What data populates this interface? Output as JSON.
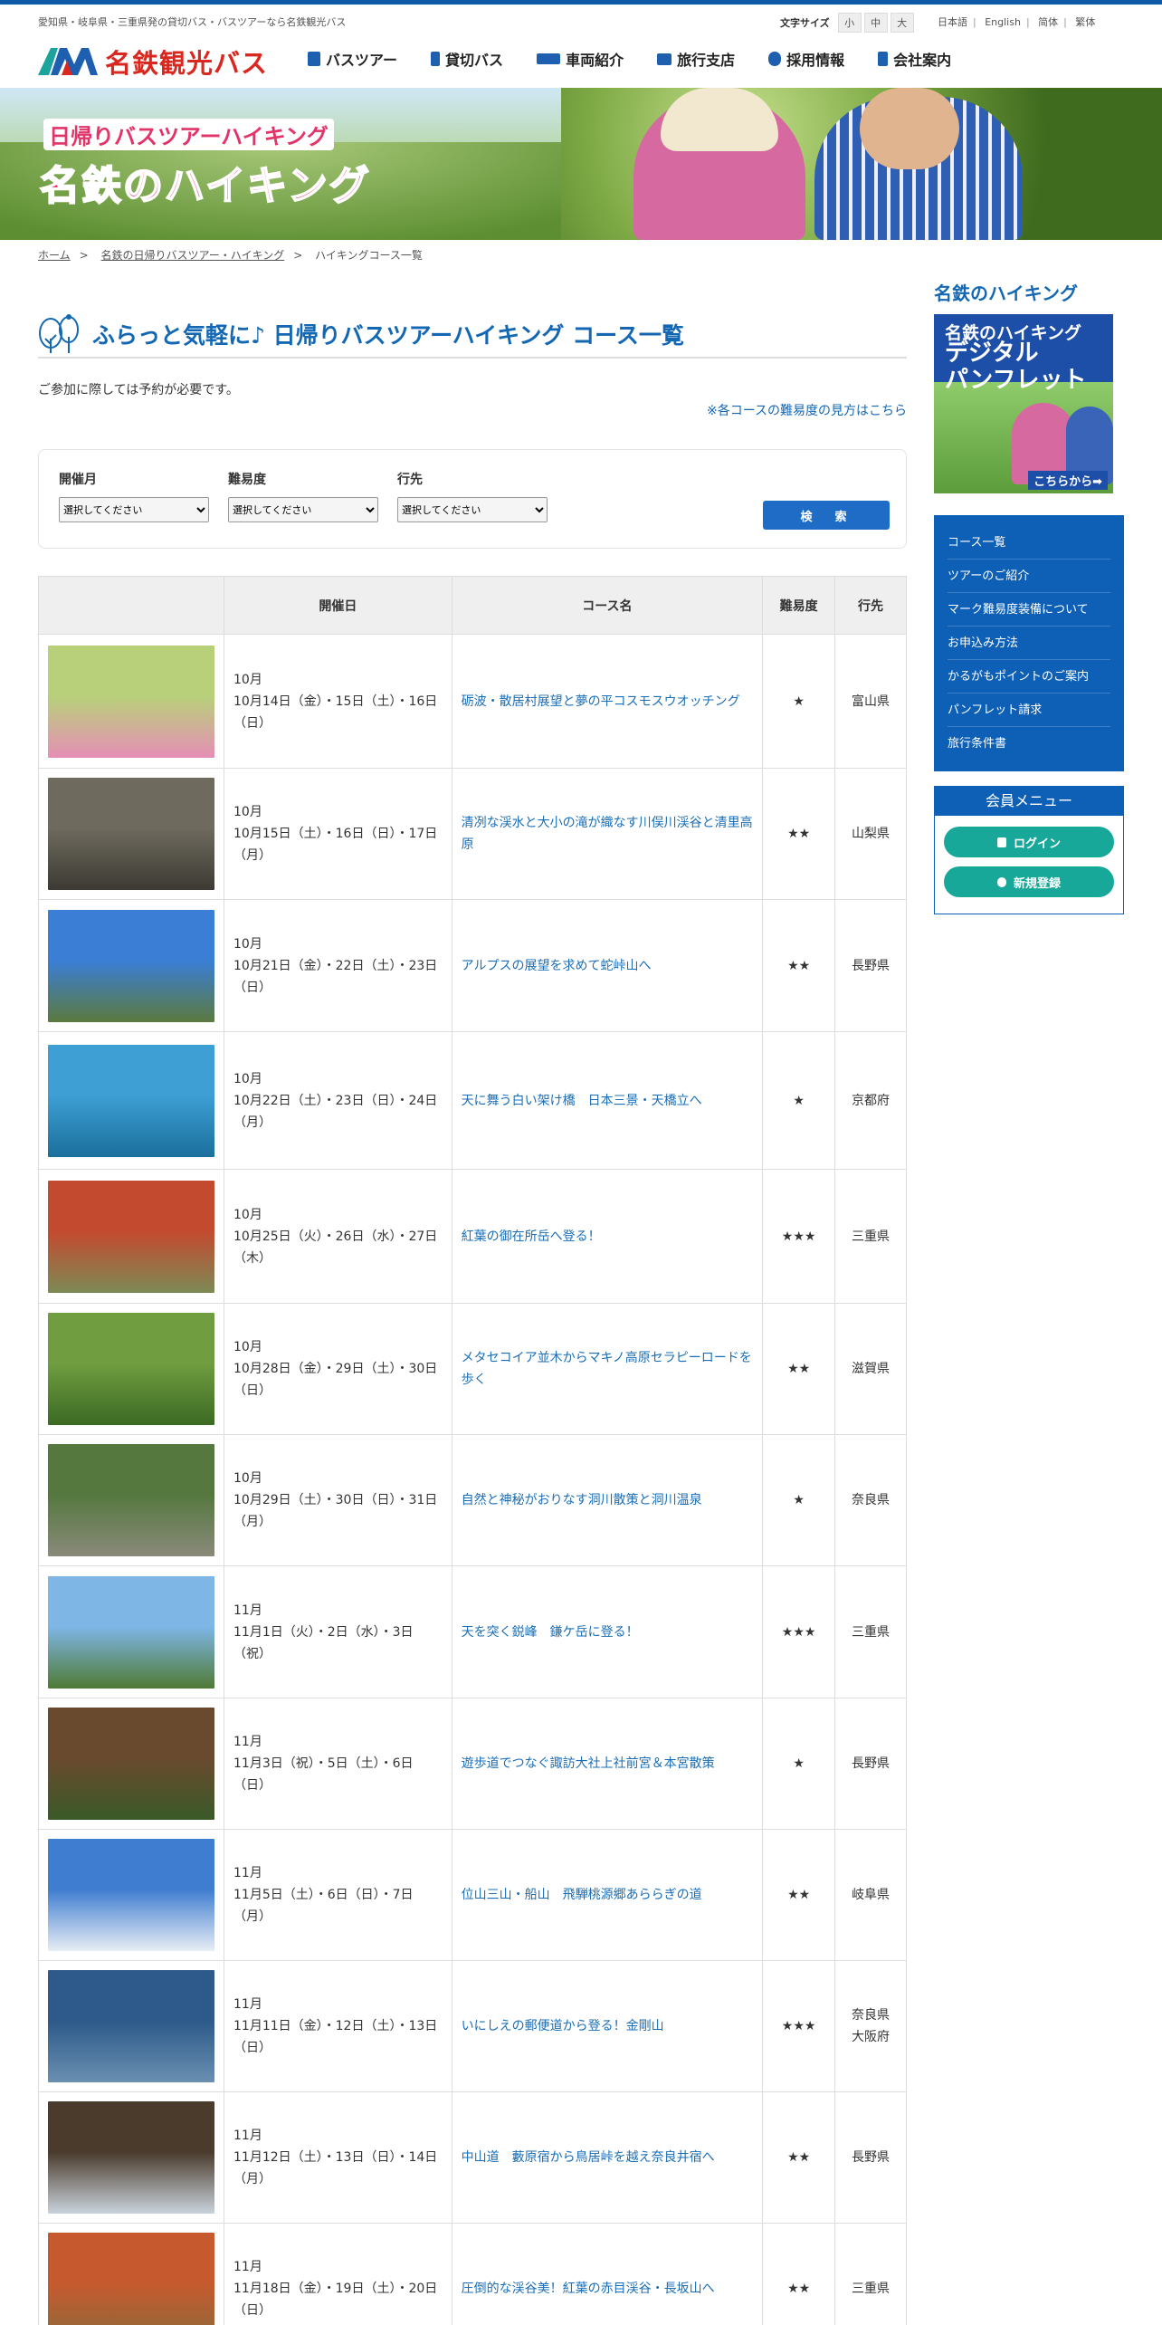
{
  "util": {
    "tagline": "愛知県・岐阜県・三重県発の貸切バス・バスツアーなら名鉄観光バス",
    "fontsize_label": "文字サイズ",
    "fontsizes": [
      "小",
      "中",
      "大"
    ],
    "langs": [
      "日本語",
      "English",
      "简体",
      "繁体"
    ]
  },
  "header": {
    "logo_text": "名鉄観光バス",
    "nav": [
      "バスツアー",
      "貸切バス",
      "車両紹介",
      "旅行支店",
      "採用情報",
      "会社案内"
    ]
  },
  "banner": {
    "line1": "日帰りバスツアーハイキング",
    "line2": "名鉄のハイキング"
  },
  "breadcrumb": [
    "ホーム",
    "名鉄の日帰りバスツアー・ハイキング",
    "ハイキングコース一覧"
  ],
  "page": {
    "title": "ふらっと気軽に♪ 日帰りバスツアーハイキング コース一覧",
    "note": "ご参加に際しては予約が必要です。",
    "difficulty_link": "※各コースの難易度の見方はこちら"
  },
  "search": {
    "fields": [
      {
        "label": "開催月",
        "value": "選択してください"
      },
      {
        "label": "難易度",
        "value": "選択してください"
      },
      {
        "label": "行先",
        "value": "選択してください"
      }
    ],
    "button": "検　索"
  },
  "table": {
    "headers": [
      "",
      "開催日",
      "コース名",
      "難易度",
      "行先"
    ],
    "rows": [
      {
        "month": "10月",
        "dates": "10月14日（金）・15日（土）・16日（日）",
        "course": "砺波・散居村展望と夢の平コスモスウオッチング",
        "diff": "★",
        "dest": "富山県",
        "c1": "#b8d07a",
        "c2": "#e58fb5"
      },
      {
        "month": "10月",
        "dates": "10月15日（土）・16日（日）・17日（月）",
        "course": "清冽な渓水と大小の滝が織なす川俣川渓谷と清里高原",
        "diff": "★★",
        "dest": "山梨県",
        "c1": "#6e6a5e",
        "c2": "#3c3a33"
      },
      {
        "month": "10月",
        "dates": "10月21日（金）・22日（土）・23日（日）",
        "course": "アルプスの展望を求めて蛇峠山へ",
        "diff": "★★",
        "dest": "長野県",
        "c1": "#3a7ed6",
        "c2": "#5b7a3e"
      },
      {
        "month": "10月",
        "dates": "10月22日（土）・23日（日）・24日（月）",
        "course": "天に舞う白い架け橋　日本三景・天橋立へ",
        "diff": "★",
        "dest": "京都府",
        "c1": "#3d9fd4",
        "c2": "#1b6f9c"
      },
      {
        "month": "10月",
        "dates": "10月25日（火）・26日（水）・27日（木）",
        "course": "紅葉の御在所岳へ登る！",
        "diff": "★★★",
        "dest": "三重県",
        "c1": "#c44a2f",
        "c2": "#7c8a55"
      },
      {
        "month": "10月",
        "dates": "10月28日（金）・29日（土）・30日（日）",
        "course": "メタセコイア並木からマキノ高原セラピーロードを歩く",
        "diff": "★★",
        "dest": "滋賀県",
        "c1": "#6f9d3f",
        "c2": "#3c6a24"
      },
      {
        "month": "10月",
        "dates": "10月29日（土）・30日（日）・31日（月）",
        "course": "自然と神秘がおりなす洞川散策と洞川温泉",
        "diff": "★",
        "dest": "奈良県",
        "c1": "#55783f",
        "c2": "#8a8a7a"
      },
      {
        "month": "11月",
        "dates": "11月1日（火）・2日（水）・3日（祝）",
        "course": "天を突く鋭峰　鎌ケ岳に登る！",
        "diff": "★★★",
        "dest": "三重県",
        "c1": "#7eb6e6",
        "c2": "#4f7a34"
      },
      {
        "month": "11月",
        "dates": "11月3日（祝）・5日（土）・6日（日）",
        "course": "遊歩道でつなぐ諏訪大社上社前宮＆本宮散策",
        "diff": "★",
        "dest": "長野県",
        "c1": "#6a4a2e",
        "c2": "#3a5a28"
      },
      {
        "month": "11月",
        "dates": "11月5日（土）・6日（日）・7日（月）",
        "course": "位山三山・船山　飛騨桃源郷あららぎの道",
        "diff": "★★",
        "dest": "岐阜県",
        "c1": "#3f7dd0",
        "c2": "#e8eef5"
      },
      {
        "month": "11月",
        "dates": "11月11日（金）・12日（土）・13日（日）",
        "course": "いにしえの郵便道から登る！金剛山",
        "diff": "★★★",
        "dest": "奈良県\n大阪府",
        "c1": "#2d5a8a",
        "c2": "#6a8fb0"
      },
      {
        "month": "11月",
        "dates": "11月12日（土）・13日（日）・14日（月）",
        "course": "中山道　藪原宿から鳥居峠を越え奈良井宿へ",
        "diff": "★★",
        "dest": "長野県",
        "c1": "#4a3b2c",
        "c2": "#c9d3dc"
      },
      {
        "month": "11月",
        "dates": "11月18日（金）・19日（土）・20日（日）",
        "course": "圧倒的な渓谷美！紅葉の赤目渓谷・長坂山へ",
        "diff": "★★",
        "dest": "三重県",
        "c1": "#c65a2e",
        "c2": "#8a6a3a"
      }
    ]
  },
  "side": {
    "title": "名鉄のハイキング",
    "pamph": {
      "a": "名鉄のハイキング",
      "b": "デジタル\nパンフレット",
      "c": "こちらから➡"
    },
    "menu": [
      "コース一覧",
      "ツアーのご紹介",
      "マーク難易度装備について",
      "お申込み方法",
      "かるがもポイントのご案内",
      "パンフレット請求",
      "旅行条件書"
    ],
    "member": {
      "title": "会員メニュー",
      "login": "ログイン",
      "register": "新規登録"
    }
  },
  "colors": {
    "brand_blue": "#1468b3",
    "logo_red": "#d9281f",
    "side_menu": "#0e5fb6",
    "member_btn": "#17a89a"
  }
}
